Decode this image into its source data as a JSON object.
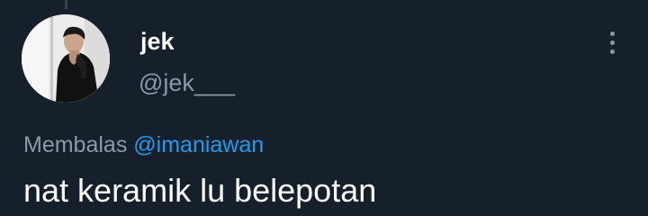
{
  "tweet": {
    "author": {
      "display_name": "jek",
      "handle": "@jek___",
      "avatar_icon": "user-avatar-photo"
    },
    "more_icon": "more-vertical-icon",
    "reply": {
      "prefix": "Membalas",
      "mention": "@imaniawan"
    },
    "text": "nat keramik lu belepotan"
  },
  "colors": {
    "background": "#15202b",
    "primary_text": "#ffffff",
    "secondary_text": "#8b98a5",
    "accent": "#1d9bf0"
  }
}
